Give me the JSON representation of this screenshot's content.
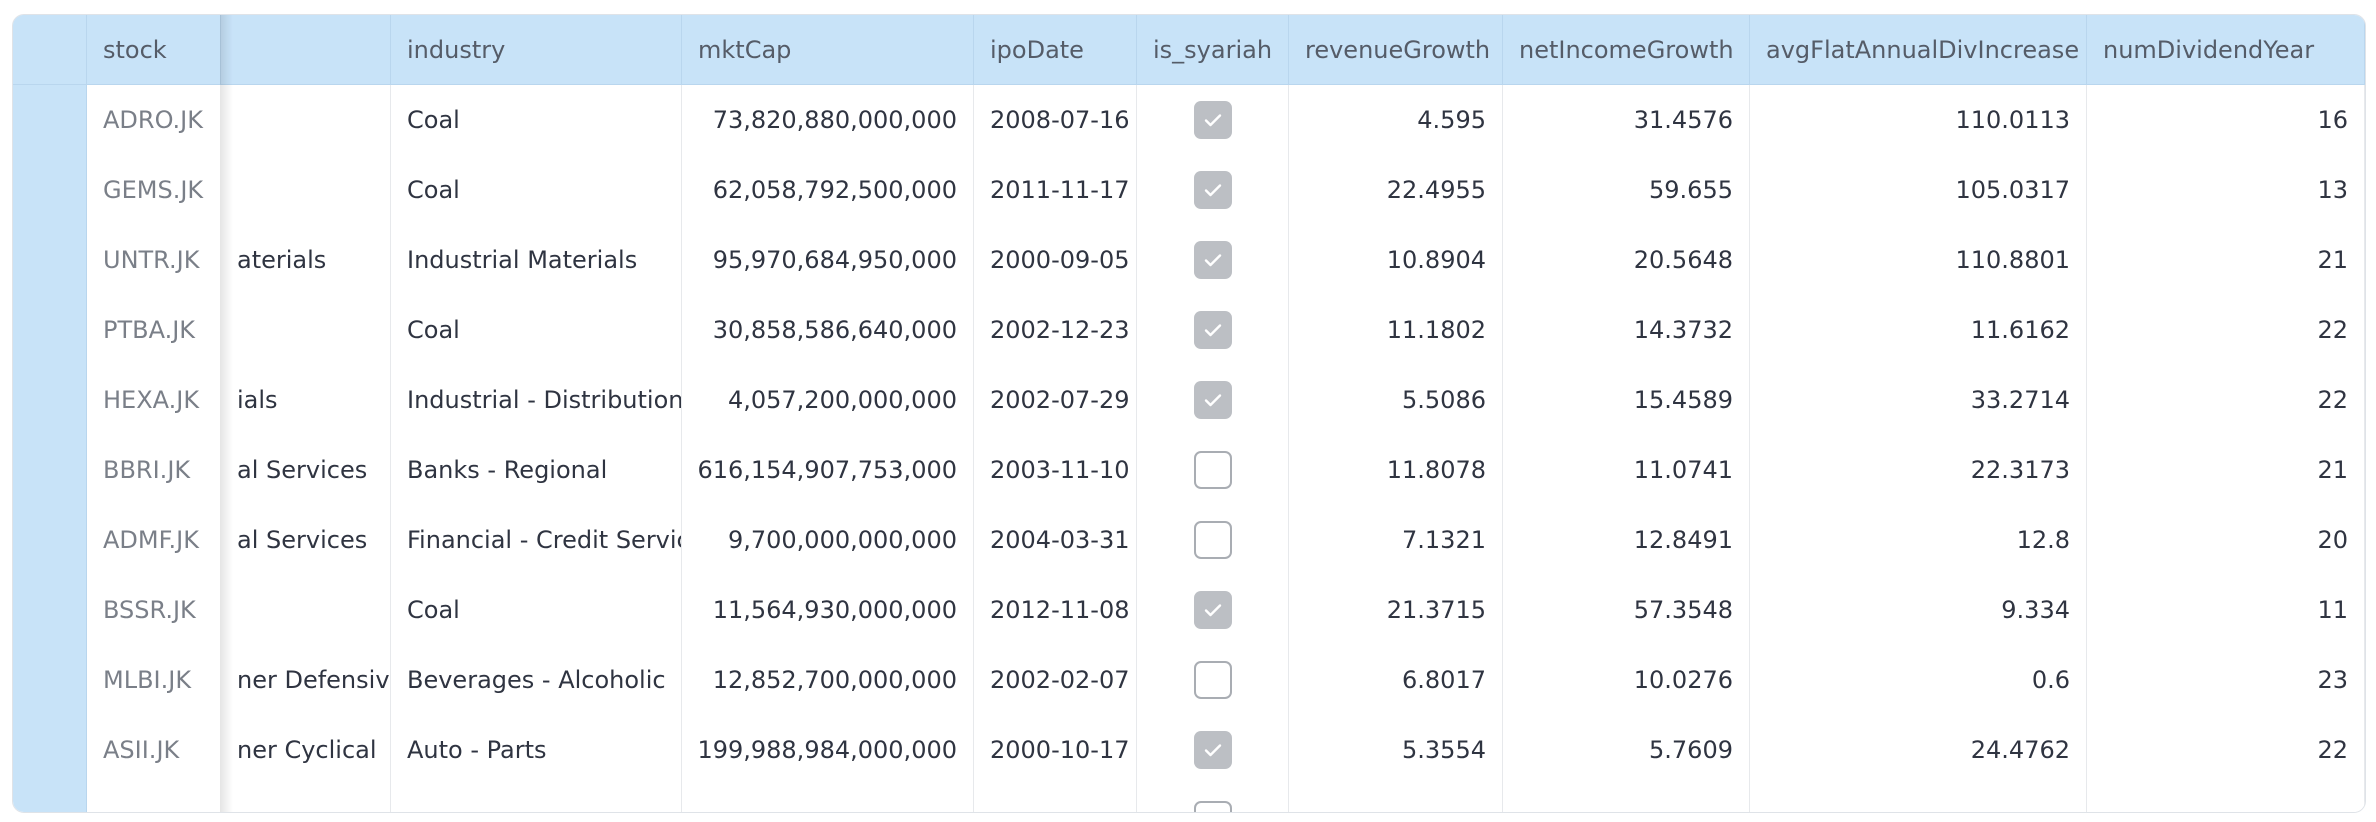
{
  "columns": {
    "stock": "stock",
    "sector": "",
    "industry": "industry",
    "mktCap": "mktCap",
    "ipoDate": "ipoDate",
    "is_syariah": "is_syariah",
    "revenueGrowth": "revenueGrowth",
    "netIncomeGrowth": "netIncomeGrowth",
    "avgFlatAnnualDivIncrease": "avgFlatAnnualDivIncrease",
    "numDividendYear": "numDividendYear"
  },
  "rows": [
    {
      "stock": "ADRO.JK",
      "sector": "",
      "industry": "Coal",
      "mktCap": "73,820,880,000,000",
      "ipoDate": "2008-07-16",
      "is_syariah": true,
      "revenueGrowth": "4.595",
      "netIncomeGrowth": "31.4576",
      "avgFlatAnnualDivIncrease": "110.0113",
      "numDividendYear": "16"
    },
    {
      "stock": "GEMS.JK",
      "sector": "",
      "industry": "Coal",
      "mktCap": "62,058,792,500,000",
      "ipoDate": "2011-11-17",
      "is_syariah": true,
      "revenueGrowth": "22.4955",
      "netIncomeGrowth": "59.655",
      "avgFlatAnnualDivIncrease": "105.0317",
      "numDividendYear": "13"
    },
    {
      "stock": "UNTR.JK",
      "sector": "aterials",
      "industry": "Industrial Materials",
      "mktCap": "95,970,684,950,000",
      "ipoDate": "2000-09-05",
      "is_syariah": true,
      "revenueGrowth": "10.8904",
      "netIncomeGrowth": "20.5648",
      "avgFlatAnnualDivIncrease": "110.8801",
      "numDividendYear": "21"
    },
    {
      "stock": "PTBA.JK",
      "sector": "",
      "industry": "Coal",
      "mktCap": "30,858,586,640,000",
      "ipoDate": "2002-12-23",
      "is_syariah": true,
      "revenueGrowth": "11.1802",
      "netIncomeGrowth": "14.3732",
      "avgFlatAnnualDivIncrease": "11.6162",
      "numDividendYear": "22"
    },
    {
      "stock": "HEXA.JK",
      "sector": "ials",
      "industry": "Industrial - Distribution",
      "mktCap": "4,057,200,000,000",
      "ipoDate": "2002-07-29",
      "is_syariah": true,
      "revenueGrowth": "5.5086",
      "netIncomeGrowth": "15.4589",
      "avgFlatAnnualDivIncrease": "33.2714",
      "numDividendYear": "22"
    },
    {
      "stock": "BBRI.JK",
      "sector": "al Services",
      "industry": "Banks - Regional",
      "mktCap": "616,154,907,753,000",
      "ipoDate": "2003-11-10",
      "is_syariah": false,
      "revenueGrowth": "11.8078",
      "netIncomeGrowth": "11.0741",
      "avgFlatAnnualDivIncrease": "22.3173",
      "numDividendYear": "21"
    },
    {
      "stock": "ADMF.JK",
      "sector": "al Services",
      "industry": "Financial - Credit Services",
      "mktCap": "9,700,000,000,000",
      "ipoDate": "2004-03-31",
      "is_syariah": false,
      "revenueGrowth": "7.1321",
      "netIncomeGrowth": "12.8491",
      "avgFlatAnnualDivIncrease": "12.8",
      "numDividendYear": "20"
    },
    {
      "stock": "BSSR.JK",
      "sector": "",
      "industry": "Coal",
      "mktCap": "11,564,930,000,000",
      "ipoDate": "2012-11-08",
      "is_syariah": true,
      "revenueGrowth": "21.3715",
      "netIncomeGrowth": "57.3548",
      "avgFlatAnnualDivIncrease": "9.334",
      "numDividendYear": "11"
    },
    {
      "stock": "MLBI.JK",
      "sector": "ner Defensive",
      "industry": "Beverages - Alcoholic",
      "mktCap": "12,852,700,000,000",
      "ipoDate": "2002-02-07",
      "is_syariah": false,
      "revenueGrowth": "6.8017",
      "netIncomeGrowth": "10.0276",
      "avgFlatAnnualDivIncrease": "0.6",
      "numDividendYear": "23"
    },
    {
      "stock": "ASII.JK",
      "sector": "ner Cyclical",
      "industry": "Auto - Parts",
      "mktCap": "199,988,984,000,000",
      "ipoDate": "2000-10-17",
      "is_syariah": true,
      "revenueGrowth": "5.3554",
      "netIncomeGrowth": "5.7609",
      "avgFlatAnnualDivIncrease": "24.4762",
      "numDividendYear": "22"
    },
    {
      "stock": "",
      "sector": "",
      "industry": "",
      "mktCap": "",
      "ipoDate": "",
      "is_syariah": false,
      "revenueGrowth": "",
      "netIncomeGrowth": "",
      "avgFlatAnnualDivIncrease": "",
      "numDividendYear": ""
    }
  ],
  "colors": {
    "header_bg": "#c8e3f8",
    "checkbox_checked": "#bcbfc4",
    "checkbox_border": "#a9adb3",
    "grid_line": "#e4e6e9"
  }
}
